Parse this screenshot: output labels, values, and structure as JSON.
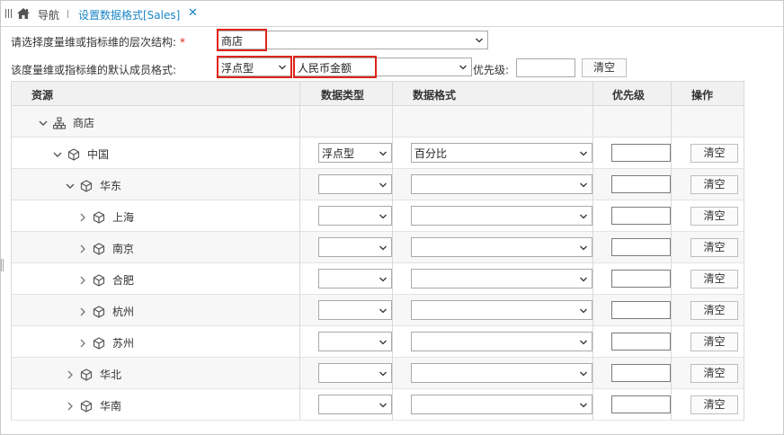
{
  "tabs": {
    "home_icon": "home-icon",
    "nav_label": "导航",
    "active_label": "设置数据格式[Sales]",
    "close_glyph": "✕"
  },
  "form": {
    "hierarchy_label": "请选择度量维或指标维的层次结构:",
    "required_mark": "*",
    "hierarchy_value": "商店",
    "default_format_label": "该度量维或指标维的默认成员格式:",
    "default_type_value": "浮点型",
    "default_format_value": "人民币金额",
    "priority_label": "优先级:",
    "priority_value": "",
    "clear_label": "清空",
    "highlight_color": "#e0241b"
  },
  "table": {
    "headers": {
      "resource": "资源",
      "data_type": "数据类型",
      "data_format": "数据格式",
      "priority": "优先级",
      "action": "操作"
    },
    "root": {
      "name": "商店",
      "expanded": true,
      "icon": "hierarchy-icon"
    },
    "rows": [
      {
        "name": "中国",
        "level": 1,
        "expanded": true,
        "type": "浮点型",
        "format": "百分比",
        "priority": "",
        "action": "清空"
      },
      {
        "name": "华东",
        "level": 2,
        "expanded": true,
        "type": "",
        "format": "",
        "priority": "",
        "action": "清空"
      },
      {
        "name": "上海",
        "level": 3,
        "expanded": false,
        "type": "",
        "format": "",
        "priority": "",
        "action": "清空"
      },
      {
        "name": "南京",
        "level": 3,
        "expanded": false,
        "type": "",
        "format": "",
        "priority": "",
        "action": "清空"
      },
      {
        "name": "合肥",
        "level": 3,
        "expanded": false,
        "type": "",
        "format": "",
        "priority": "",
        "action": "清空"
      },
      {
        "name": "杭州",
        "level": 3,
        "expanded": false,
        "type": "",
        "format": "",
        "priority": "",
        "action": "清空"
      },
      {
        "name": "苏州",
        "level": 3,
        "expanded": false,
        "type": "",
        "format": "",
        "priority": "",
        "action": "清空"
      },
      {
        "name": "华北",
        "level": 2,
        "expanded": false,
        "type": "",
        "format": "",
        "priority": "",
        "action": "清空"
      },
      {
        "name": "华南",
        "level": 2,
        "expanded": false,
        "type": "",
        "format": "",
        "priority": "",
        "action": "清空"
      }
    ],
    "member_icon": "cube-icon"
  },
  "colors": {
    "accent": "#1a86c8",
    "header_bg": "#f1f1f1",
    "alt_row_bg": "#f7f7f7",
    "border": "#d9d9d9"
  }
}
